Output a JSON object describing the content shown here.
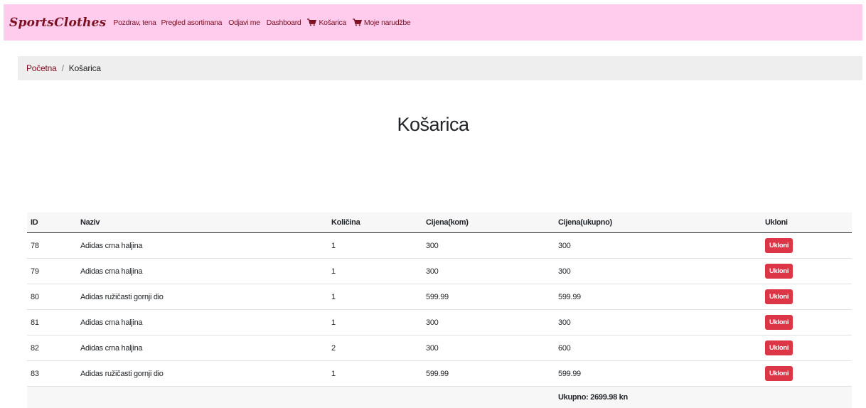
{
  "nav": {
    "brand": "SportsClothes",
    "greeting": "Pozdrav, tena",
    "links": [
      "Pregled asortimana",
      "Odjavi me",
      "Dashboard"
    ],
    "cart": "Košarica",
    "orders": "Moje narudžbe"
  },
  "breadcrumb": {
    "home": "Početna",
    "separator": "/",
    "current": "Košarica"
  },
  "page": {
    "title": "Košarica"
  },
  "table": {
    "headers": {
      "id": "ID",
      "naziv": "Naziv",
      "kolicina": "Količina",
      "cijena_kom": "Cijena(kom)",
      "cijena_ukupno": "Cijena(ukupno)",
      "ukloni": "Ukloni"
    },
    "remove_label": "Ukloni",
    "rows": [
      {
        "id": "78",
        "naziv": "Adidas crna haljina",
        "kolicina": "1",
        "cijena_kom": "300",
        "cijena_ukupno": "300"
      },
      {
        "id": "79",
        "naziv": "Adidas crna haljina",
        "kolicina": "1",
        "cijena_kom": "300",
        "cijena_ukupno": "300"
      },
      {
        "id": "80",
        "naziv": "Adidas ružičasti gornji dio",
        "kolicina": "1",
        "cijena_kom": "599.99",
        "cijena_ukupno": "599.99"
      },
      {
        "id": "81",
        "naziv": "Adidas crna haljina",
        "kolicina": "1",
        "cijena_kom": "300",
        "cijena_ukupno": "300"
      },
      {
        "id": "82",
        "naziv": "Adidas crna haljina",
        "kolicina": "2",
        "cijena_kom": "300",
        "cijena_ukupno": "600"
      },
      {
        "id": "83",
        "naziv": "Adidas ružičasti gornji dio",
        "kolicina": "1",
        "cijena_kom": "599.99",
        "cijena_ukupno": "599.99"
      }
    ],
    "total": "Ukupno: 2699.98 kn"
  },
  "colors": {
    "navbar_bg": "#ffccee",
    "link": "#7a1020",
    "danger": "#dc3545",
    "breadcrumb_bg": "#eeeeee"
  },
  "icons": {
    "cart": "shopping-cart-icon"
  }
}
